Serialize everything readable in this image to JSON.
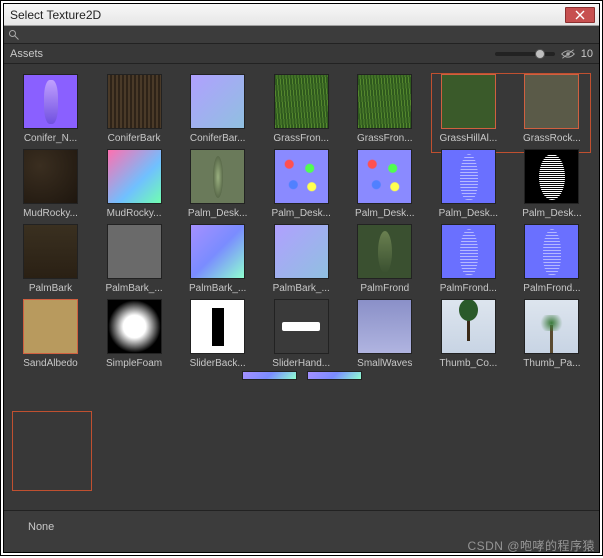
{
  "window": {
    "title": "Select Texture2D",
    "close_icon": "close"
  },
  "search": {
    "icon": "magnifier",
    "value": ""
  },
  "tabs": {
    "assets_label": "Assets",
    "hidden_count": "10"
  },
  "footer": {
    "selection": "None"
  },
  "watermark": "CSDN @咆哮的程序猿",
  "grid": {
    "rows": [
      [
        {
          "label": "Conifer_N...",
          "art": "conifer"
        },
        {
          "label": "ConiferBark",
          "art": "bark"
        },
        {
          "label": "ConiferBar...",
          "art": "barknorm"
        },
        {
          "label": "GrassFron...",
          "art": "grass"
        },
        {
          "label": "GrassFron...",
          "art": "grass"
        },
        {
          "label": "GrassHillAl...",
          "art": "grassmap",
          "hl": true
        },
        {
          "label": "GrassRock...",
          "art": "rockmap",
          "hl": true
        }
      ],
      [
        {
          "label": "MudRocky...",
          "art": "mud"
        },
        {
          "label": "MudRocky...",
          "art": "mudn"
        },
        {
          "label": "Palm_Desk...",
          "art": "leaf"
        },
        {
          "label": "Palm_Desk...",
          "art": "palmsplat"
        },
        {
          "label": "Palm_Desk...",
          "art": "palmsplat"
        },
        {
          "label": "Palm_Desk...",
          "art": "frondblue"
        },
        {
          "label": "Palm_Desk...",
          "art": "frondbw"
        }
      ],
      [
        {
          "label": "PalmBark",
          "art": "treebark"
        },
        {
          "label": "PalmBark_...",
          "art": "barkgrey"
        },
        {
          "label": "PalmBark_...",
          "art": "normal"
        },
        {
          "label": "PalmBark_...",
          "art": "barknorm"
        },
        {
          "label": "PalmFrond",
          "art": "frondphoto"
        },
        {
          "label": "PalmFrond...",
          "art": "frondblue"
        },
        {
          "label": "PalmFrond...",
          "art": "frondblue"
        }
      ],
      [
        {
          "label": "SandAlbedo",
          "art": "sand",
          "hl": true
        },
        {
          "label": "SimpleFoam",
          "art": "foam"
        },
        {
          "label": "SliderBack...",
          "art": "sliderbg"
        },
        {
          "label": "SliderHand...",
          "art": "sliderhd"
        },
        {
          "label": "SmallWaves",
          "art": "waves"
        },
        {
          "label": "Thumb_Co...",
          "art": "thumbtree"
        },
        {
          "label": "Thumb_Pa...",
          "art": "thumbpalm"
        }
      ]
    ],
    "overflow": [
      {
        "art": "normal"
      },
      {
        "art": "normal"
      }
    ]
  }
}
